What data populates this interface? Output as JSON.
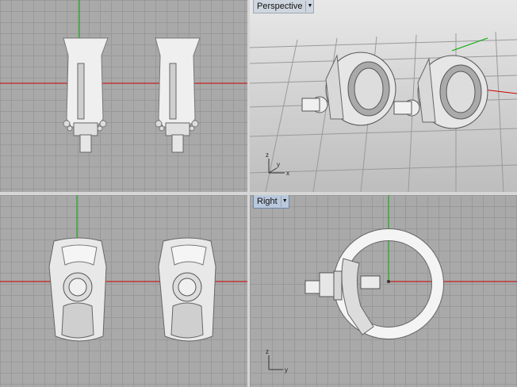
{
  "viewports": {
    "top": {
      "label": ""
    },
    "perspective": {
      "label": "Perspective"
    },
    "front": {
      "label": ""
    },
    "right": {
      "label": "Right"
    }
  },
  "triad": {
    "x": "x",
    "y": "y",
    "z": "z"
  },
  "colors": {
    "bg": "#a9a9a9",
    "grid": "#999999",
    "x_axis": "#cc0000",
    "y_axis": "#00aa00",
    "model": "#f2f2f2"
  }
}
